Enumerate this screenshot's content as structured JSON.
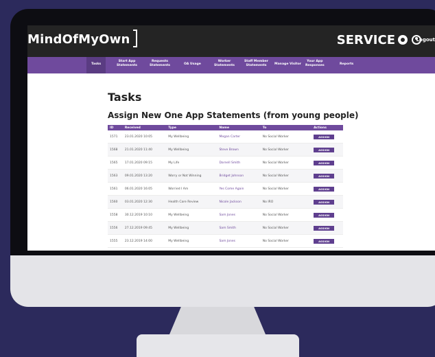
{
  "topbar": {
    "logo": "MindOfMyOwn",
    "service_label": "SERVICE",
    "logout_label": "Logout"
  },
  "nav": {
    "items": [
      {
        "label": "Tasks"
      },
      {
        "label": "Start App\nStatements"
      },
      {
        "label": "Requests\nStatements"
      },
      {
        "label": "OA Usage"
      },
      {
        "label": "Worker\nStatements"
      },
      {
        "label": "Staff Member\nStatements"
      },
      {
        "label": "Manage Visitor"
      },
      {
        "label": "Your App\nResponses"
      },
      {
        "label": "Reports"
      }
    ]
  },
  "main": {
    "title": "Tasks",
    "section_title": "Assign New One App Statements (from young people)",
    "columns": [
      "ID",
      "Received",
      "Type",
      "Name",
      "To",
      "Actions"
    ],
    "rows": [
      {
        "id": "1571",
        "received": "23.01.2020 10:05",
        "type": "My Wellbeing",
        "name": "Megan Carter",
        "to": "No Social Worker",
        "action": "ASSIGN"
      },
      {
        "id": "1568",
        "received": "21.01.2020 11:40",
        "type": "My Wellbeing",
        "name": "Steve Brown",
        "to": "No Social Worker",
        "action": "ASSIGN"
      },
      {
        "id": "1565",
        "received": "17.01.2020 09:15",
        "type": "My Life",
        "name": "Darnell Smith",
        "to": "No Social Worker",
        "action": "ASSIGN"
      },
      {
        "id": "1563",
        "received": "09.01.2020 13:20",
        "type": "Worry or Not Winning",
        "name": "Bridget Johnson",
        "to": "No Social Worker",
        "action": "ASSIGN"
      },
      {
        "id": "1561",
        "received": "06.01.2020 16:05",
        "type": "Worried I Am",
        "name": "Yes Come Again",
        "to": "No Social Worker",
        "action": "ASSIGN"
      },
      {
        "id": "1560",
        "received": "03.01.2020 12:30",
        "type": "Health Care Review",
        "name": "Nicole Jackson",
        "to": "No IRO",
        "action": "ASSIGN"
      },
      {
        "id": "1558",
        "received": "30.12.2019 10:10",
        "type": "My Wellbeing",
        "name": "Sam Jones",
        "to": "No Social Worker",
        "action": "ASSIGN"
      },
      {
        "id": "1556",
        "received": "27.12.2019 09:45",
        "type": "My Wellbeing",
        "name": "Sam Smith",
        "to": "No Social Worker",
        "action": "ASSIGN"
      },
      {
        "id": "1555",
        "received": "23.12.2019 14:00",
        "type": "My Wellbeing",
        "name": "Sam Jones",
        "to": "No Social Worker",
        "action": "ASSIGN"
      }
    ]
  }
}
